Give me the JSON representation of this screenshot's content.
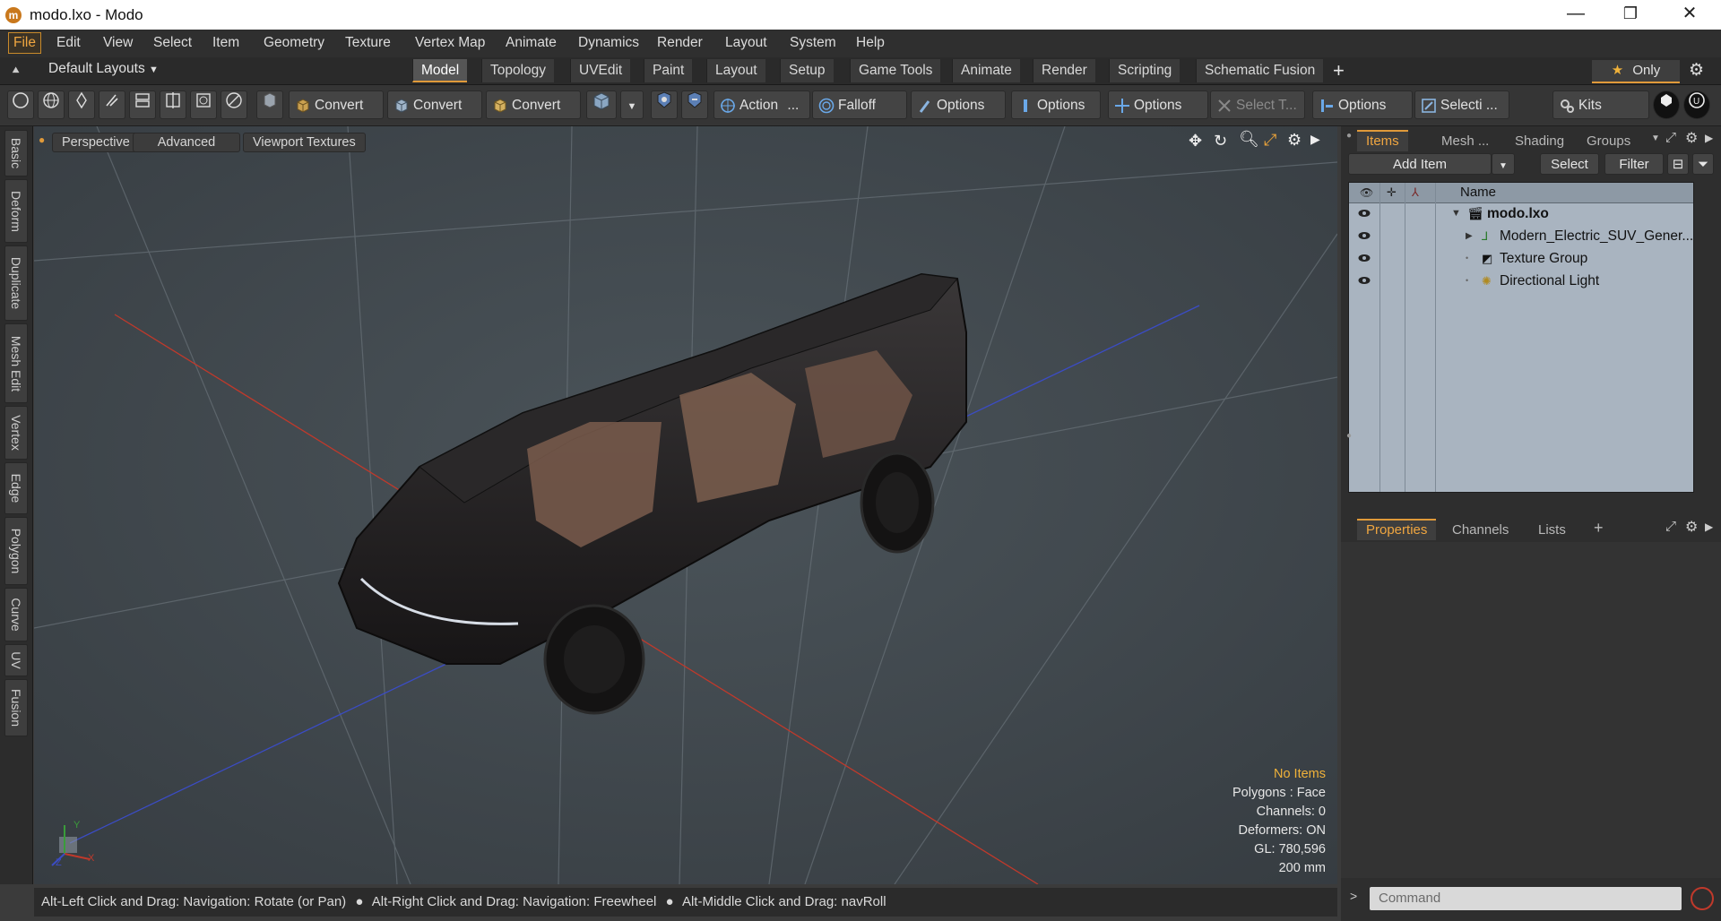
{
  "window": {
    "title": "modo.lxo - Modo",
    "minimize": "—",
    "maximize": "❐",
    "close": "✕"
  },
  "menu": [
    "File",
    "Edit",
    "View",
    "Select",
    "Item",
    "Geometry",
    "Texture",
    "Vertex Map",
    "Animate",
    "Dynamics",
    "Render",
    "Layout",
    "System",
    "Help"
  ],
  "layouts": {
    "selector": "Default Layouts",
    "tabs": [
      "Model",
      "Topology",
      "UVEdit",
      "Paint",
      "Layout",
      "Setup",
      "Game Tools",
      "Animate",
      "Render",
      "Scripting",
      "Schematic Fusion"
    ],
    "active_tab": "Model",
    "add": "+",
    "only": "Only"
  },
  "toolbar": {
    "convert1": "Convert",
    "convert2": "Convert",
    "convert3": "Convert",
    "action": "Action",
    "action_more": "...",
    "falloff": "Falloff",
    "options1": "Options",
    "options2": "Options",
    "options3": "Options",
    "select_t": "Select T...",
    "options4": "Options",
    "selecti": "Selecti ...",
    "kits": "Kits"
  },
  "left_tabs": [
    "Basic",
    "Deform",
    "Duplicate",
    "Mesh Edit",
    "Vertex",
    "Edge",
    "Polygon",
    "Curve",
    "UV",
    "Fusion"
  ],
  "viewport": {
    "view": "Perspective",
    "shading": "Advanced",
    "textures": "Viewport Textures",
    "info": {
      "no_items": "No Items",
      "polygons": "Polygons : Face",
      "channels": "Channels: 0",
      "deformers": "Deformers: ON",
      "gl": "GL: 780,596",
      "scale": "200 mm"
    },
    "axis_labels": {
      "y": "Y",
      "x": "X",
      "z": "Z"
    }
  },
  "statusbar": {
    "hint1": "Alt-Left Click and Drag: Navigation: Rotate (or Pan)",
    "hint2": "Alt-Right Click and Drag: Navigation: Freewheel",
    "hint3": "Alt-Middle Click and Drag: navRoll"
  },
  "items_panel": {
    "tabs": [
      "Items",
      "Mesh ...",
      "Shading",
      "Groups"
    ],
    "active_tab": "Items",
    "add_item": "Add Item",
    "select": "Select",
    "filter": "Filter",
    "column_name": "Name",
    "tree": [
      {
        "label": "modo.lxo",
        "icon": "scene-icon"
      },
      {
        "label": "Modern_Electric_SUV_Gener...",
        "icon": "mesh-locator-icon"
      },
      {
        "label": "Texture Group",
        "icon": "texture-group-icon"
      },
      {
        "label": "Directional Light",
        "icon": "light-icon"
      }
    ]
  },
  "properties_panel": {
    "tabs": [
      "Properties",
      "Channels",
      "Lists"
    ],
    "active_tab": "Properties",
    "add": "+"
  },
  "command": {
    "placeholder": "Command",
    "prompt": ">"
  },
  "colors": {
    "accent": "#e09a3a",
    "viewport_bg": "#40474c",
    "tree_bg": "#a9b4c0",
    "x_axis": "#c0392b",
    "z_axis": "#3b4cc4"
  }
}
